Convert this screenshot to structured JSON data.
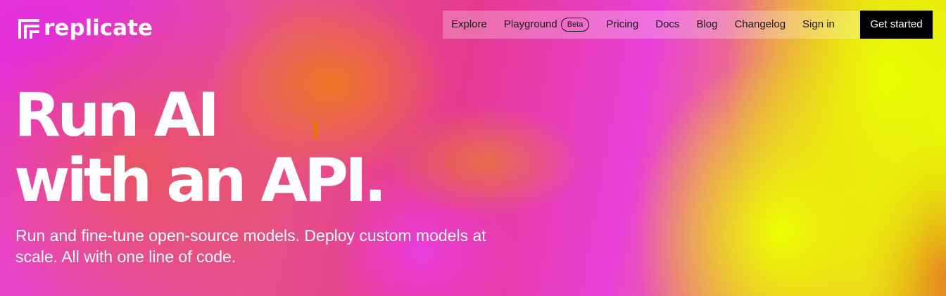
{
  "brand": {
    "logo_text": "replicate"
  },
  "nav": {
    "items": [
      {
        "label": "Explore"
      },
      {
        "label": "Playground",
        "badge": "Beta"
      },
      {
        "label": "Pricing"
      },
      {
        "label": "Docs"
      },
      {
        "label": "Blog"
      },
      {
        "label": "Changelog"
      },
      {
        "label": "Sign in"
      }
    ],
    "cta_label": "Get started"
  },
  "hero": {
    "headline_line1": "Run AI",
    "headline_line2": "with an API.",
    "subtext": "Run and fine-tune open-source models. Deploy custom models at scale. All with one line of code."
  },
  "colors": {
    "magenta": "#e83ed8",
    "pink": "#e6508a",
    "orange": "#f09a40",
    "yellow": "#e8ff00",
    "cta_bg": "#000000",
    "text_light": "#ffffff"
  },
  "icons": {
    "logo": "replicate-logo-icon"
  }
}
